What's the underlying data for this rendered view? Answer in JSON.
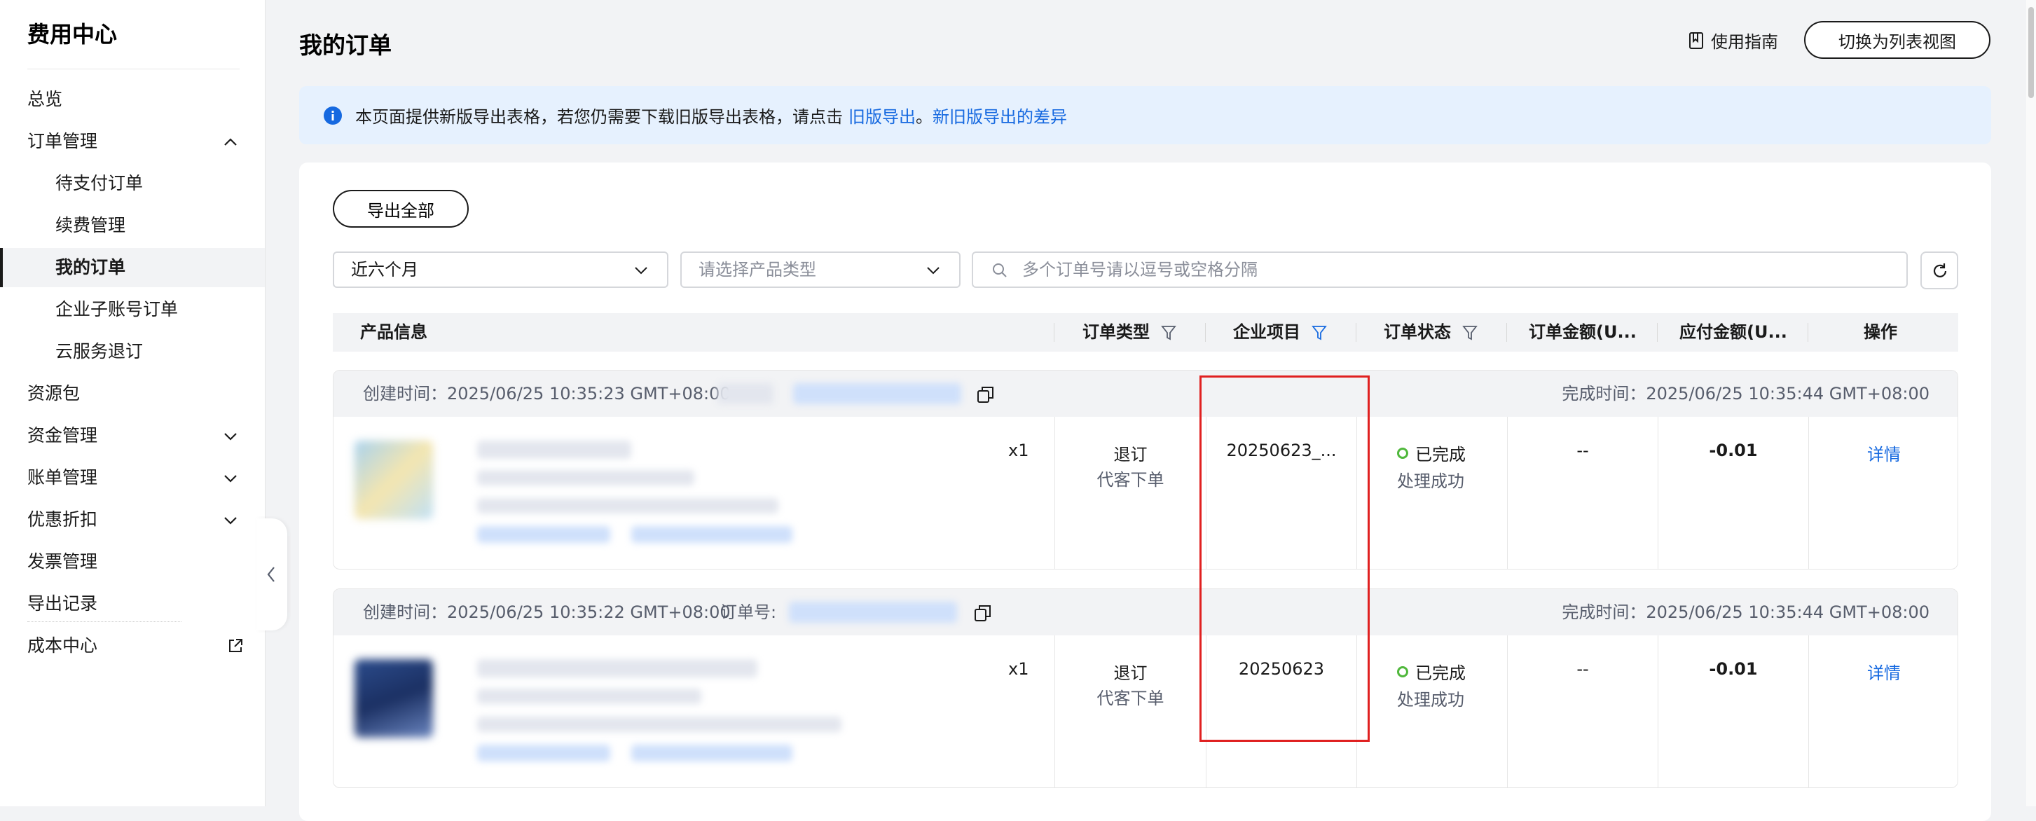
{
  "sidebar": {
    "title": "费用中心",
    "items": [
      {
        "label": "总览"
      },
      {
        "label": "订单管理"
      },
      {
        "label": "待支付订单"
      },
      {
        "label": "续费管理"
      },
      {
        "label": "我的订单"
      },
      {
        "label": "企业子账号订单"
      },
      {
        "label": "云服务退订"
      },
      {
        "label": "资源包"
      },
      {
        "label": "资金管理"
      },
      {
        "label": "账单管理"
      },
      {
        "label": "优惠折扣"
      },
      {
        "label": "发票管理"
      },
      {
        "label": "导出记录"
      },
      {
        "label": "成本中心"
      }
    ]
  },
  "header": {
    "title": "我的订单",
    "guide_label": "使用指南",
    "switch_label": "切换为列表视图"
  },
  "banner": {
    "text": "本页面提供新版导出表格，若您仍需要下载旧版导出表格，请点击",
    "link1": "旧版导出",
    "sep": "。",
    "link2": "新旧版导出的差异"
  },
  "toolbar": {
    "export_all": "导出全部",
    "period_value": "近六个月",
    "product_placeholder": "请选择产品类型",
    "search_placeholder": "多个订单号请以逗号或空格分隔"
  },
  "table": {
    "columns": [
      "产品信息",
      "订单类型",
      "企业项目",
      "订单状态",
      "订单金额(U...",
      "应付金额(U...",
      "操作"
    ]
  },
  "orders": [
    {
      "created": "创建时间：2025/06/25 10:35:23 GMT+08:00",
      "order_no_label": "",
      "completed": "完成时间：2025/06/25 10:35:44 GMT+08:00",
      "qty": "x1",
      "type": "退订",
      "type_sub": "代客下单",
      "project": "20250623_...",
      "status": "已完成",
      "status_sub": "处理成功",
      "order_amount": "--",
      "payable": "-0.01",
      "action": "详情"
    },
    {
      "created": "创建时间：2025/06/25 10:35:22 GMT+08:00",
      "order_no_label": "订单号:",
      "completed": "完成时间：2025/06/25 10:35:44 GMT+08:00",
      "qty": "x1",
      "type": "退订",
      "type_sub": "代客下单",
      "project": "20250623",
      "status": "已完成",
      "status_sub": "处理成功",
      "order_amount": "--",
      "payable": "-0.01",
      "action": "详情"
    }
  ],
  "colors": {
    "link": "#1669e0",
    "banner_bg": "#e6f1fe",
    "success": "#50b83c",
    "highlight_box": "#e02020"
  }
}
